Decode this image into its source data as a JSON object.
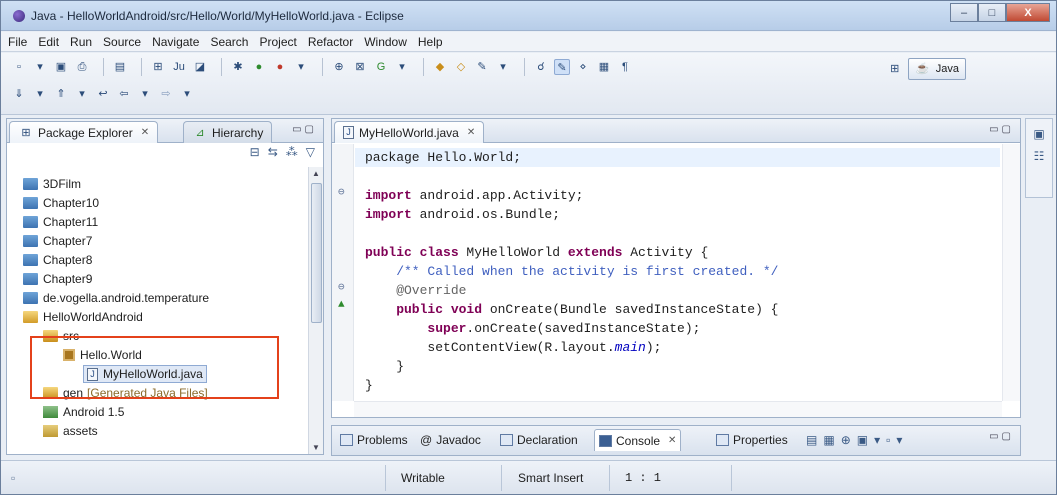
{
  "window": {
    "title": "Java - HelloWorldAndroid/src/Hello/World/MyHelloWorld.java - Eclipse",
    "minimize": "–",
    "maximize": "□",
    "close": "X"
  },
  "menu": [
    "File",
    "Edit",
    "Run",
    "Source",
    "Navigate",
    "Search",
    "Project",
    "Refactor",
    "Window",
    "Help"
  ],
  "perspective": {
    "label": "Java"
  },
  "package_explorer": {
    "tabs": [
      {
        "label": "Package Explorer",
        "close": "✕"
      },
      {
        "label": "Hierarchy"
      }
    ],
    "tree": [
      {
        "label": "3DFilm",
        "icon": "folder-icon"
      },
      {
        "label": "Chapter10",
        "icon": "folder-icon"
      },
      {
        "label": "Chapter11",
        "icon": "folder-icon"
      },
      {
        "label": "Chapter7",
        "icon": "folder-icon"
      },
      {
        "label": "Chapter8",
        "icon": "folder-icon"
      },
      {
        "label": "Chapter9",
        "icon": "folder-icon"
      },
      {
        "label": "de.vogella.android.temperature",
        "icon": "folder-icon"
      },
      {
        "label": "HelloWorldAndroid",
        "icon": "project-icon"
      },
      {
        "label": "src",
        "icon": "source-folder-icon"
      },
      {
        "label": "Hello.World",
        "icon": "package-icon"
      },
      {
        "label": "MyHelloWorld.java",
        "icon": "java-file-icon"
      },
      {
        "label": "gen",
        "extra": "[Generated Java Files]",
        "icon": "source-folder-icon"
      },
      {
        "label": "Android 1.5",
        "icon": "library-icon"
      },
      {
        "label": "assets",
        "icon": "assets-folder-icon"
      }
    ]
  },
  "editor": {
    "tab": {
      "label": "MyHelloWorld.java",
      "close": "✕"
    },
    "lines": {
      "l1": "package Hello.World;",
      "l2a": "import",
      "l2b": " android.app.Activity;",
      "l3a": "import",
      "l3b": " android.os.Bundle;",
      "l4a": "public class",
      "l4b": " MyHelloWorld ",
      "l4c": "extends",
      "l4d": " Activity {",
      "l5": "    /** Called when the activity is first created. */",
      "l6": "    @Override",
      "l7a": "    public void",
      "l7b": " onCreate(Bundle savedInstanceState) {",
      "l8a": "        super",
      "l8b": ".onCreate(savedInstanceState);",
      "l9a": "        setContentView(R.layout.",
      "l9b": "main",
      "l9c": ");",
      "l10": "    }",
      "l11": "}"
    }
  },
  "bottom_tabs": [
    {
      "label": "Problems"
    },
    {
      "label": "Javadoc"
    },
    {
      "label": "Declaration"
    },
    {
      "label": "Console",
      "close": "✕"
    },
    {
      "label": "Properties"
    }
  ],
  "status": {
    "writable": "Writable",
    "insert_mode": "Smart Insert",
    "position": "1 : 1"
  },
  "colors": {
    "highlight": "#e4411b",
    "keyword": "#7f0055",
    "comment": "#3f5fbf"
  }
}
